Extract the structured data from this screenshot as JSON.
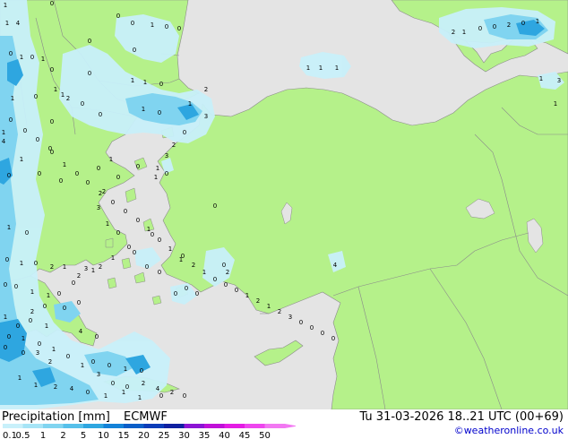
{
  "footer": {
    "title": "Precipitation [mm]",
    "model": "ECMWF",
    "valid": "Tu 31-03-2026 18..21 UTC (00+69)",
    "credit": "©weatheronline.co.uk"
  },
  "legend": {
    "labels": [
      "0.1",
      "0.5",
      "1",
      "2",
      "5",
      "10",
      "15",
      "20",
      "25",
      "30",
      "35",
      "40",
      "45",
      "50"
    ],
    "colors": [
      "#c8f0fa",
      "#a6e4f6",
      "#80d4f0",
      "#56c0ea",
      "#2ea6e0",
      "#1382d8",
      "#0a5ec8",
      "#0b3cb8",
      "#1020a0",
      "#8c14d4",
      "#c010d8",
      "#e41ce4",
      "#ee46ee",
      "#f278f2"
    ]
  },
  "colors": {
    "land": "#b5f18a",
    "sea": "#e4e4e4",
    "border": "#8a8a8a",
    "precip_light": "#c8f0fa",
    "precip_medium": "#80d4f0",
    "precip_heavy": "#2ea6e0"
  },
  "map_labels": [
    "1",
    "4",
    "0",
    "1",
    "0",
    "0",
    "1",
    "0",
    "1",
    "0",
    "1",
    "1",
    "2",
    "0",
    "0",
    "0",
    "1",
    "0",
    "0",
    "0",
    "1",
    "1",
    "0",
    "2",
    "1",
    "0",
    "1",
    "0",
    "0",
    "1",
    "1",
    "0",
    "0",
    "0",
    "1",
    "0",
    "0",
    "0",
    "0",
    "1",
    "0",
    "4",
    "1",
    "0",
    "1",
    "0",
    "0",
    "1",
    "0",
    "2",
    "1",
    "2",
    "1",
    "0",
    "0",
    "1",
    "1",
    "0",
    "0",
    "1",
    "0",
    "1",
    "0",
    "0",
    "3",
    "2",
    "1",
    "1",
    "2",
    "4",
    "0",
    "1",
    "1",
    "1",
    "0",
    "0",
    "0",
    "1",
    "0",
    "4",
    "0",
    "0",
    "0",
    "0",
    "0",
    "1",
    "0",
    "0",
    "0",
    "0",
    "0",
    "1",
    "1",
    "1",
    "2",
    "1",
    "0",
    "0",
    "2",
    "0",
    "1",
    "1",
    "3",
    "1",
    "4",
    "2",
    "3",
    "0",
    "2",
    "3",
    "1",
    "0",
    "2",
    "3",
    "1",
    "0",
    "0",
    "1",
    "2",
    "3",
    "0",
    "0",
    "0",
    "2",
    "0",
    "0",
    "1",
    "0",
    "1",
    "0",
    "1",
    "3",
    "0",
    "0",
    "2",
    "4",
    "2",
    "0",
    "0",
    "0",
    "0",
    "0",
    "1",
    "0",
    "0",
    "2",
    "0",
    "0",
    "0",
    "1",
    "0",
    "1",
    "0",
    "2",
    "1",
    "0",
    "0",
    "0",
    "1",
    "2",
    "1",
    "2",
    "3",
    "0",
    "0",
    "0",
    "0"
  ]
}
